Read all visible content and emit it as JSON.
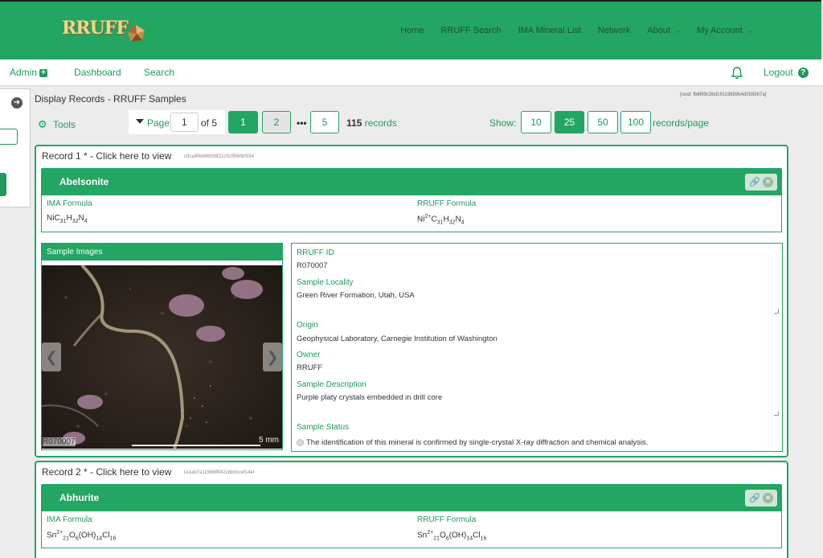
{
  "header": {
    "logo_text": "RRUFF",
    "nav": [
      {
        "label": "Home",
        "caret": false
      },
      {
        "label": "RRUFF Search",
        "caret": false
      },
      {
        "label": "IMA Mineral List",
        "caret": false
      },
      {
        "label": "Network",
        "caret": false
      },
      {
        "label": "About",
        "caret": true
      },
      {
        "label": "My Account",
        "caret": true
      }
    ]
  },
  "subnav": {
    "admin": "Admin",
    "dashboard": "Dashboard",
    "search": "Search",
    "logout": "Logout"
  },
  "page": {
    "title": "Display Records - RRUFF Samples",
    "uuid": "[uuid: fb6f69c3bd16119659b4d058967a]",
    "tools": "Tools"
  },
  "pager": {
    "label": "Page",
    "current": "1",
    "of": "of 5",
    "pages": [
      "1",
      "2",
      "5"
    ],
    "ellipsis": "•••",
    "records_count": "115",
    "records_label": "records",
    "show_label": "Show:",
    "sizes": [
      "10",
      "25",
      "50",
      "100"
    ],
    "per_page_label": "records/page"
  },
  "records": [
    {
      "title": "Record 1 * - Click here to view",
      "hash": "c9ca9f4d66936f21c5c9560bf934",
      "mineral": "Abelsonite",
      "ima_label": "IMA Formula",
      "rruff_label": "RRUFF Formula",
      "images_label": "Sample Images",
      "image_caption": "R070007",
      "scale": "5 mm",
      "fields": {
        "rruff_id_label": "RRUFF ID",
        "rruff_id": "R070007",
        "locality_label": "Sample Locality",
        "locality": "Green River Formation, Utah, USA",
        "origin_label": "Origin",
        "origin": "Geophysical Laboratory, Carnegie Institution of Washington",
        "owner_label": "Owner",
        "owner": "RRUFF",
        "description_label": "Sample Description",
        "description": "Purple platy crystals embedded in drill core",
        "status_label": "Sample Status",
        "status": "The identification of this mineral is confirmed by single-crystal X-ray diffraction and chemical analysis."
      }
    },
    {
      "title": "Record 2 * - Click here to view",
      "hash": "1e1ab7a11566ff942cbb0ccef14ef",
      "mineral": "Abhurite",
      "ima_label": "IMA Formula",
      "rruff_label": "RRUFF Formula"
    }
  ],
  "colors": {
    "primary": "#23a563",
    "text_green": "#1f9a5c"
  },
  "icons": [
    "plus-square-icon",
    "bell-icon",
    "question-circle-icon",
    "gear-icon",
    "caret-down-icon",
    "arrow-right-circle-icon",
    "link-icon",
    "close-circle-icon",
    "chevron-left-icon",
    "chevron-right-icon"
  ]
}
